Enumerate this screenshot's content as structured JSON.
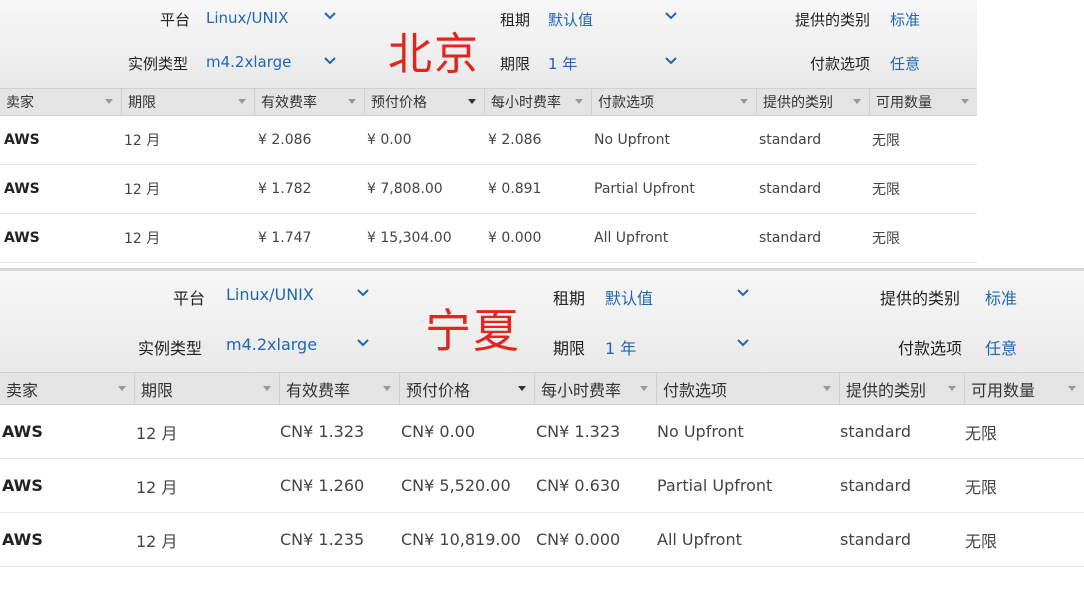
{
  "panels": [
    {
      "region": "北京",
      "filters": {
        "platform_label": "平台",
        "platform_value": "Linux/UNIX",
        "tenancy_label": "租期",
        "tenancy_value": "默认值",
        "offering_class_label": "提供的类别",
        "offering_class_value": "标准",
        "instance_type_label": "实例类型",
        "instance_type_value": "m4.2xlarge",
        "term_label": "期限",
        "term_value": "1 年",
        "payment_label": "付款选项",
        "payment_value": "任意"
      },
      "columns": [
        "卖家",
        "期限",
        "有效费率",
        "预付价格",
        "每小时费率",
        "付款选项",
        "提供的类别",
        "可用数量"
      ],
      "rows": [
        [
          "AWS",
          "12 月",
          "¥ 2.086",
          "¥ 0.00",
          "¥ 2.086",
          "No Upfront",
          "standard",
          "无限"
        ],
        [
          "AWS",
          "12 月",
          "¥ 1.782",
          "¥ 7,808.00",
          "¥ 0.891",
          "Partial Upfront",
          "standard",
          "无限"
        ],
        [
          "AWS",
          "12 月",
          "¥ 1.747",
          "¥ 15,304.00",
          "¥ 0.000",
          "All Upfront",
          "standard",
          "无限"
        ]
      ]
    },
    {
      "region": "宁夏",
      "filters": {
        "platform_label": "平台",
        "platform_value": "Linux/UNIX",
        "tenancy_label": "租期",
        "tenancy_value": "默认值",
        "offering_class_label": "提供的类别",
        "offering_class_value": "标准",
        "instance_type_label": "实例类型",
        "instance_type_value": "m4.2xlarge",
        "term_label": "期限",
        "term_value": "1 年",
        "payment_label": "付款选项",
        "payment_value": "任意"
      },
      "columns": [
        "卖家",
        "期限",
        "有效费率",
        "预付价格",
        "每小时费率",
        "付款选项",
        "提供的类别",
        "可用数量"
      ],
      "rows": [
        [
          "AWS",
          "12 月",
          "CN¥ 1.323",
          "CN¥ 0.00",
          "CN¥ 1.323",
          "No Upfront",
          "standard",
          "无限"
        ],
        [
          "AWS",
          "12 月",
          "CN¥ 1.260",
          "CN¥ 5,520.00",
          "CN¥ 0.630",
          "Partial Upfront",
          "standard",
          "无限"
        ],
        [
          "AWS",
          "12 月",
          "CN¥ 1.235",
          "CN¥ 10,819.00",
          "CN¥ 0.000",
          "All Upfront",
          "standard",
          "无限"
        ]
      ]
    }
  ],
  "colors": {
    "link": "#1f66b3",
    "region_annotation": "#e0261f",
    "header_bg": "#e4e4e4"
  },
  "icons": {
    "dropdown": "chevron-down-icon",
    "sort": "sort-caret-icon"
  }
}
